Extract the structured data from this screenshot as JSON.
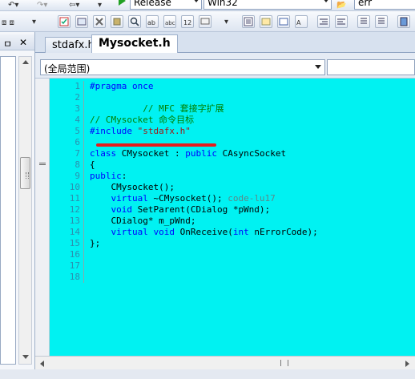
{
  "toolbar": {
    "config_value": "Release",
    "platform_value": "Win32",
    "find_value": "err"
  },
  "left_panel": {
    "pin_label": "ㅁ",
    "close_label": "✕"
  },
  "tabs": [
    {
      "label": "stdafx.h"
    },
    {
      "label": "Mysocket.h"
    }
  ],
  "scope": {
    "value": "(全局范围)"
  },
  "code_lines": [
    {
      "num": "1",
      "parts": [
        {
          "t": "kw",
          "s": "#pragma once"
        }
      ]
    },
    {
      "num": "2",
      "parts": []
    },
    {
      "num": "3",
      "parts": [
        {
          "t": "cm",
          "s": "          // MFC 套接字扩展"
        }
      ]
    },
    {
      "num": "4",
      "parts": [
        {
          "t": "cm",
          "s": "// CMysocket 命令目标"
        }
      ]
    },
    {
      "num": "5",
      "parts": [
        {
          "t": "kw",
          "s": "#include "
        },
        {
          "t": "str",
          "s": "\"stdafx.h\""
        }
      ]
    },
    {
      "num": "6",
      "parts": []
    },
    {
      "num": "7",
      "parts": [
        {
          "t": "kw",
          "s": "class "
        },
        {
          "t": "tx",
          "s": "CMysocket : "
        },
        {
          "t": "kw",
          "s": "public "
        },
        {
          "t": "tx",
          "s": "CAsyncSocket"
        }
      ]
    },
    {
      "num": "8",
      "parts": [
        {
          "t": "tx",
          "s": "{"
        }
      ]
    },
    {
      "num": "9",
      "parts": [
        {
          "t": "kw",
          "s": "public"
        },
        {
          "t": "tx",
          "s": ":"
        }
      ]
    },
    {
      "num": "10",
      "parts": [
        {
          "t": "tx",
          "s": "    CMysocket();"
        }
      ]
    },
    {
      "num": "11",
      "parts": [
        {
          "t": "kw",
          "s": "    virtual "
        },
        {
          "t": "tx",
          "s": "~CMysocket();"
        },
        {
          "t": "gray",
          "s": " code-lu17"
        }
      ]
    },
    {
      "num": "12",
      "parts": [
        {
          "t": "kw",
          "s": "    void "
        },
        {
          "t": "tx",
          "s": "SetParent(CDialog *pWnd);"
        }
      ]
    },
    {
      "num": "13",
      "parts": [
        {
          "t": "tx",
          "s": "    CDialog* m_pWnd;"
        }
      ]
    },
    {
      "num": "14",
      "parts": [
        {
          "t": "kw",
          "s": "    virtual void "
        },
        {
          "t": "tx",
          "s": "OnReceive("
        },
        {
          "t": "kw",
          "s": "int "
        },
        {
          "t": "tx",
          "s": "nErrorCode);"
        }
      ]
    },
    {
      "num": "15",
      "parts": [
        {
          "t": "tx",
          "s": "};"
        }
      ]
    },
    {
      "num": "16",
      "parts": []
    },
    {
      "num": "17",
      "parts": []
    },
    {
      "num": "18",
      "parts": []
    }
  ],
  "colors": {
    "editor_bg": "#00f2f2",
    "keyword": "#0000ff",
    "comment": "#008000",
    "string": "#a31515",
    "line_number": "#2b91af",
    "annotation_red": "#e81b1b"
  }
}
